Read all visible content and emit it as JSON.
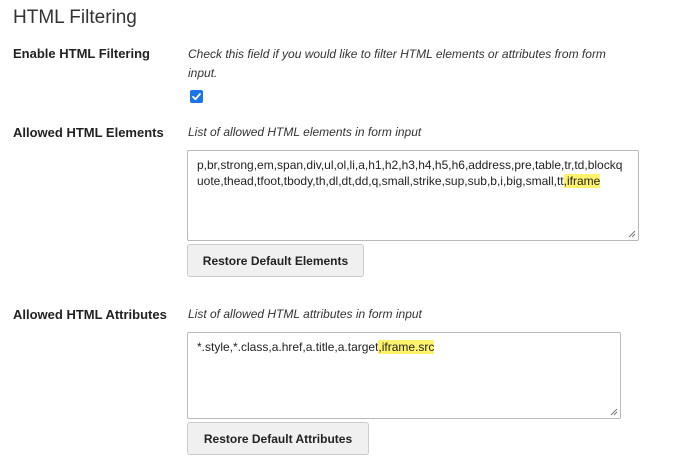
{
  "section": {
    "title": "HTML Filtering"
  },
  "enable_filtering": {
    "label": "Enable HTML Filtering",
    "help": "Check this field if you would like to filter HTML elements or attributes from form input.",
    "checked": true
  },
  "allowed_elements": {
    "label": "Allowed HTML Elements",
    "help": "List of allowed HTML elements in form input",
    "value_main": "p,br,strong,em,span,div,ul,ol,li,a,h1,h2,h3,h4,h5,h6,address,pre,table,tr,td,blockquote,thead,tfoot,tbody,th,dl,dt,dd,q,small,strike,sup,sub,b,i,big,small,tt",
    "value_highlight": ",iframe",
    "restore_label": "Restore Default Elements"
  },
  "allowed_attributes": {
    "label": "Allowed HTML Attributes",
    "help": "List of allowed HTML attributes in form input",
    "value_main": "*.style,*.class,a.href,a.title,a.target",
    "value_highlight": ",iframe.src",
    "restore_label": "Restore Default Attributes"
  },
  "colors": {
    "highlight": "#fff36b",
    "checkbox_accent": "#1a73e8"
  }
}
